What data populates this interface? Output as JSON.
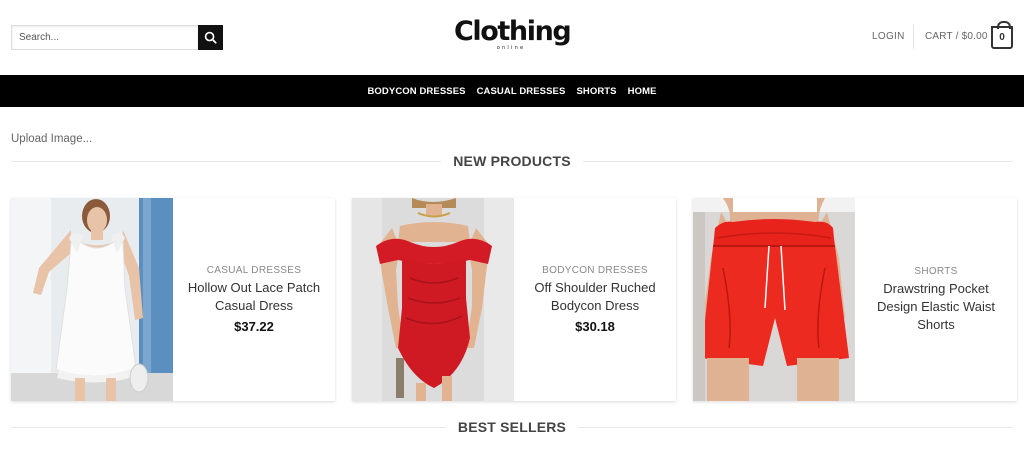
{
  "search": {
    "placeholder": "Search..."
  },
  "logo": {
    "main": "Clothing",
    "sub": "online"
  },
  "header": {
    "login": "LOGIN",
    "cart": "CART / $0.00",
    "cart_count": "0"
  },
  "nav": {
    "items": [
      "BODYCON DRESSES",
      "CASUAL DRESSES",
      "SHORTS",
      "HOME"
    ]
  },
  "upload_text": "Upload Image...",
  "sections": {
    "new_products": "NEW PRODUCTS",
    "best_sellers": "BEST SELLERS"
  },
  "products": [
    {
      "category": "CASUAL DRESSES",
      "name": "Hollow Out Lace Patch Casual Dress",
      "price": "$37.22",
      "image": "white-lace-dress-photo"
    },
    {
      "category": "BODYCON DRESSES",
      "name": "Off Shoulder Ruched Bodycon Dress",
      "price": "$30.18",
      "image": "red-bodycon-dress-photo"
    },
    {
      "category": "SHORTS",
      "name": "Drawstring Pocket Design Elastic Waist Shorts",
      "price": "",
      "image": "red-shorts-photo"
    }
  ],
  "colors": {
    "nav_bg": "#000000",
    "accent_red": "#e8231c"
  }
}
